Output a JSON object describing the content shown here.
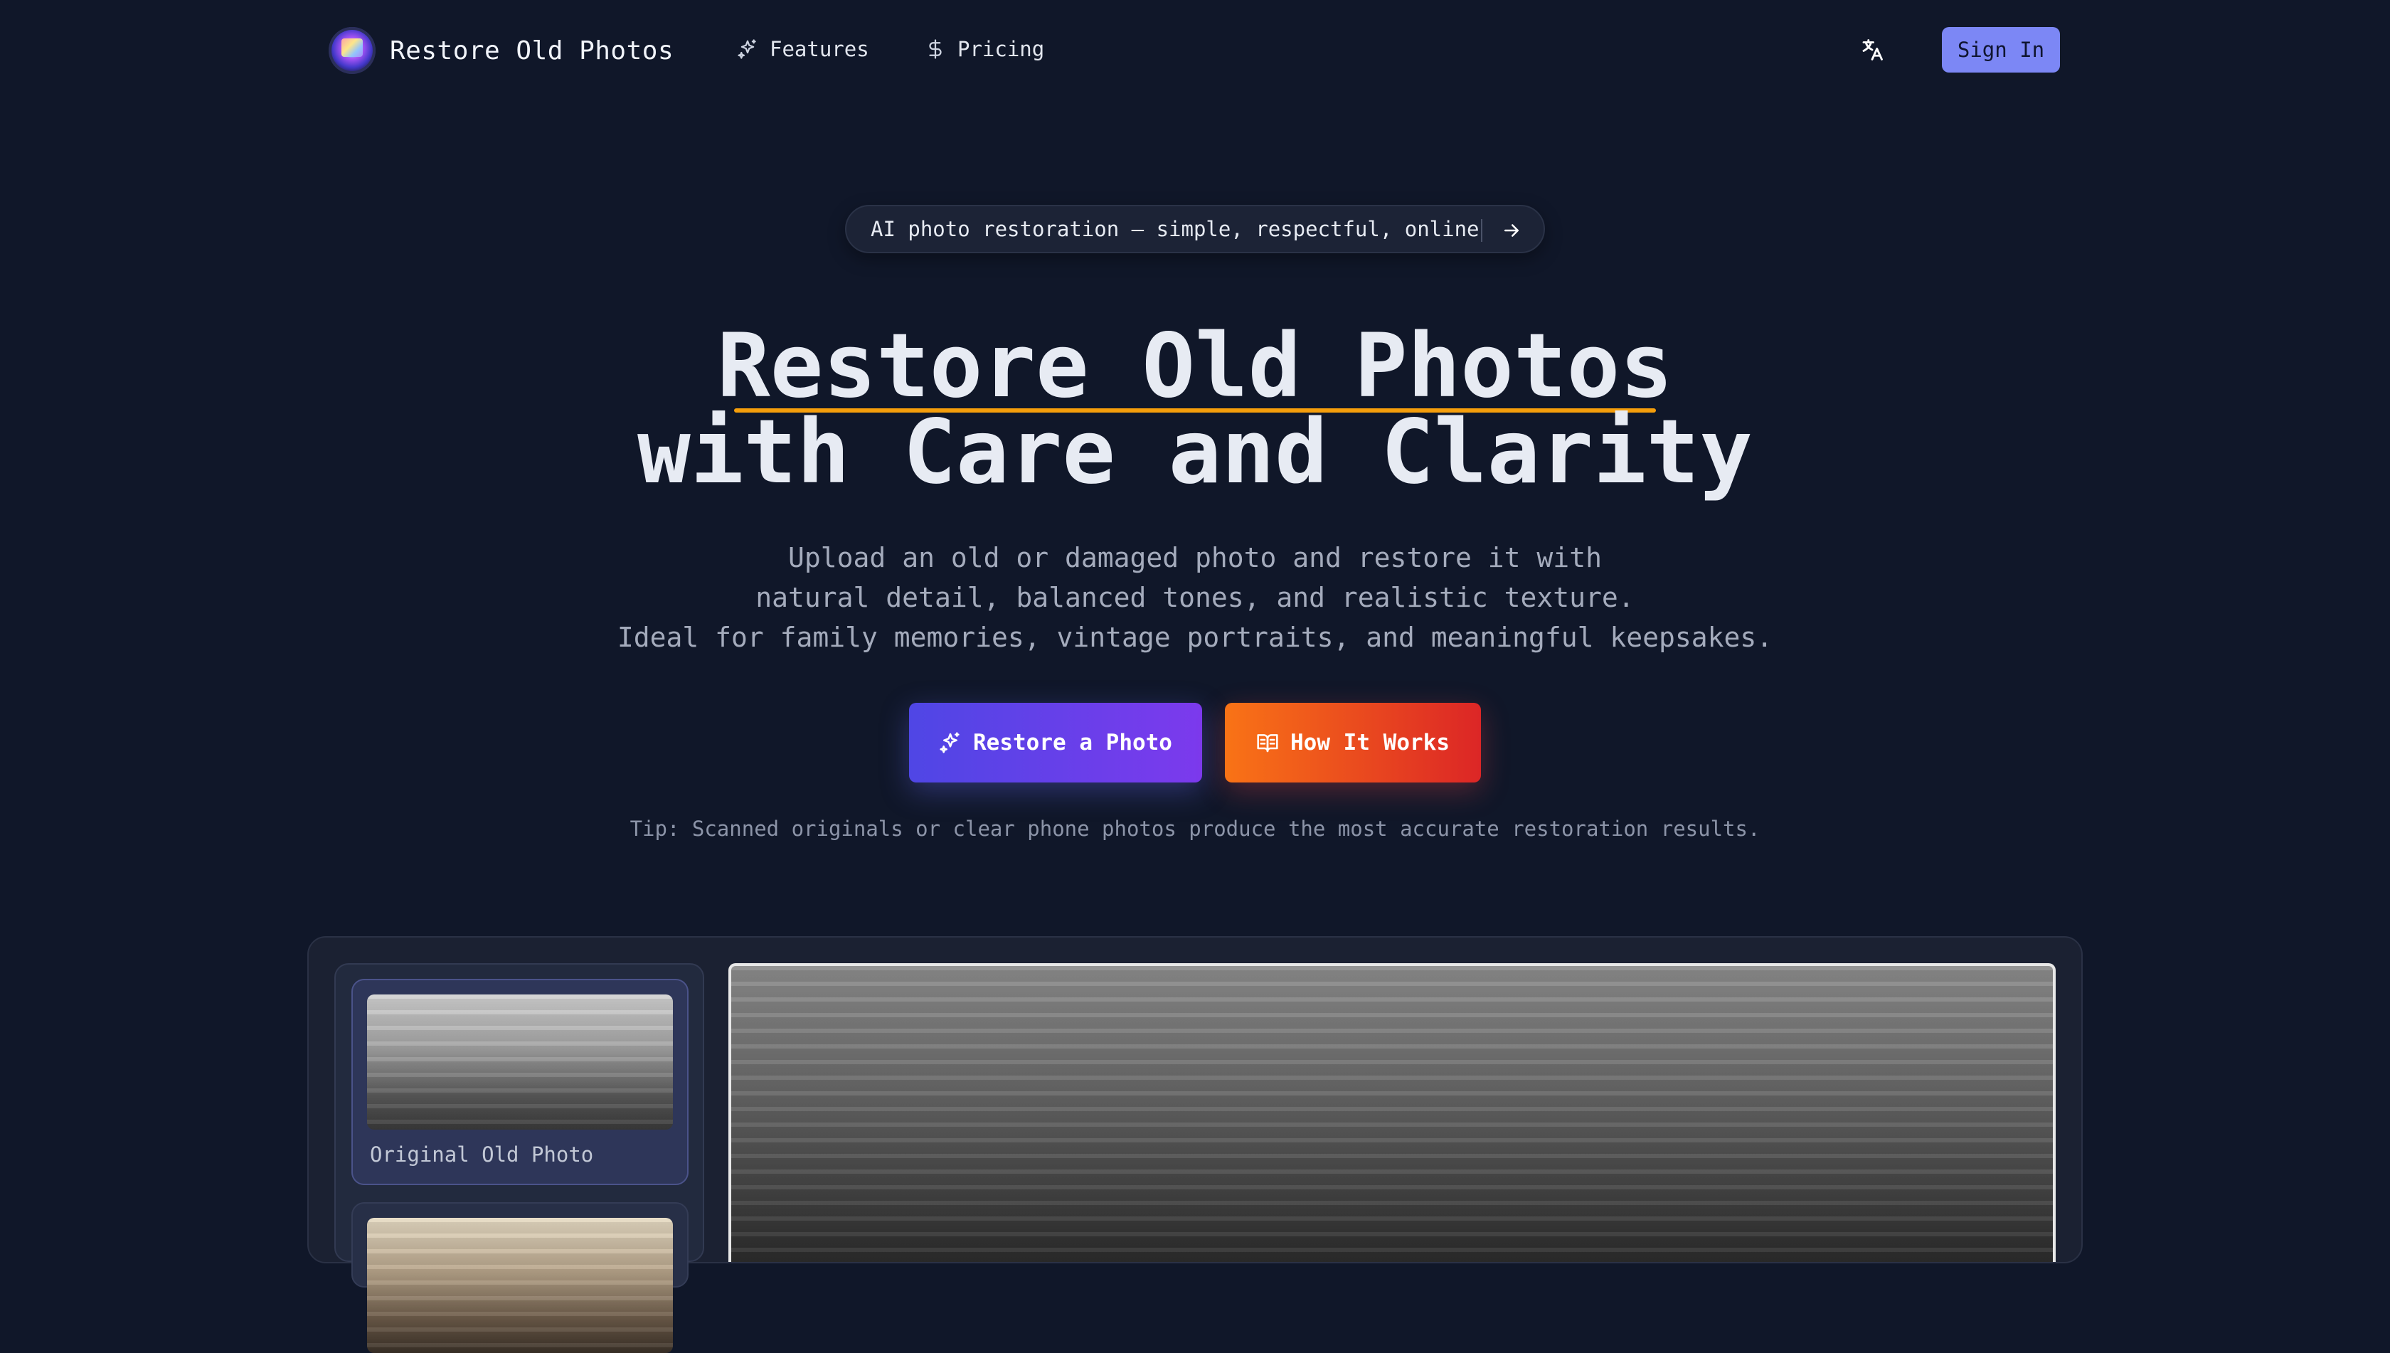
{
  "nav": {
    "brand": "Restore Old Photos",
    "links": [
      {
        "label": "Features",
        "icon": "sparkles-icon"
      },
      {
        "label": "Pricing",
        "icon": "dollar-icon"
      }
    ],
    "language_icon": "translate-icon",
    "sign_in": "Sign In"
  },
  "hero": {
    "badge": "AI photo restoration — simple, respectful, online",
    "title_line1": "Restore Old Photos",
    "title_line2": "with Care and Clarity",
    "subtitle": [
      "Upload an old or damaged photo and restore it with",
      "natural detail, balanced tones, and realistic texture.",
      "Ideal for family memories, vintage portraits, and meaningful keepsakes."
    ],
    "primary_cta": "Restore a Photo",
    "secondary_cta": "How It Works",
    "tip": "Tip: Scanned originals or clear phone photos produce the most accurate restoration results."
  },
  "gallery": {
    "items": [
      {
        "label": "Original Old Photo"
      }
    ]
  },
  "colors": {
    "background": "#101729",
    "accent": "#7c87f5",
    "underline": "#f59e0b",
    "primary_gradient": [
      "#4f46e5",
      "#7c3aed"
    ],
    "secondary_gradient": [
      "#f97316",
      "#dc2626"
    ]
  }
}
